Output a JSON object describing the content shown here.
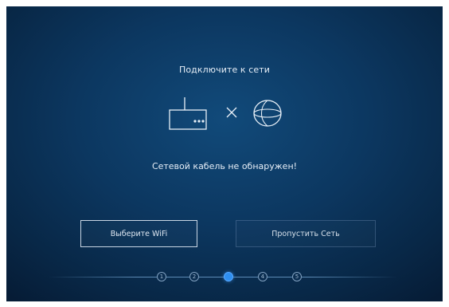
{
  "dialog": {
    "title": "Подключите к сети",
    "message": "Сетевой кабель не обнаружен!",
    "separator_symbol": "×"
  },
  "icons": {
    "left": "router-icon",
    "middle": "x-icon",
    "right": "globe-icon"
  },
  "buttons": {
    "wifi_label": "Выберите WiFi",
    "skip_label": "Пропустить Сеть"
  },
  "stepper": {
    "steps": [
      "1",
      "2",
      "3",
      "4",
      "5"
    ],
    "active_step": 3
  },
  "colors": {
    "background_center": "#114a7a",
    "background_edge": "#061c36",
    "text": "#e6eef7",
    "active_step": "#2f8ff0"
  }
}
